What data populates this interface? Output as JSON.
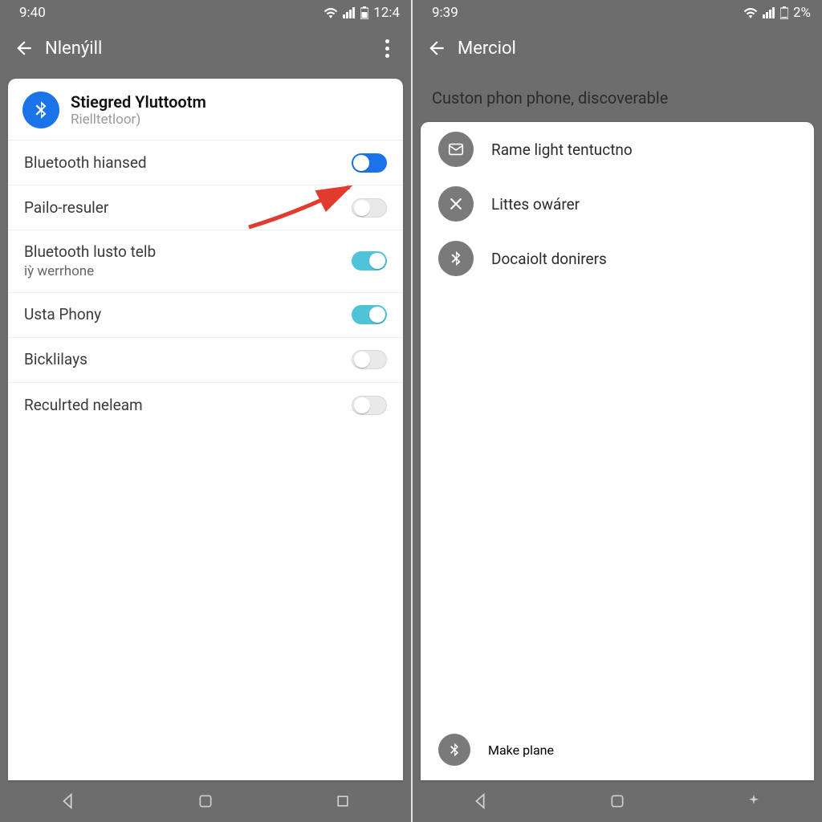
{
  "colors": {
    "accent_blue": "#1a73e8",
    "accent_teal": "#4fc3d8",
    "bg": "#6d6d6d"
  },
  "left": {
    "status": {
      "time": "9:40",
      "battery": "12:4"
    },
    "appbar": {
      "title": "Nlenýill"
    },
    "bt_header": {
      "title": "Stiegred Yluttootm",
      "subtitle": "Rielltetloor)"
    },
    "rows": [
      {
        "label": "Bluetooth hiansed",
        "sub": "",
        "state": "on-blue-dotleft"
      },
      {
        "label": "Pailo-resuler",
        "sub": "",
        "state": "off"
      },
      {
        "label": "Bluetooth lusto telb",
        "sub": "iỳ werrhone",
        "state": "on-teal"
      },
      {
        "label": "Usta Phony",
        "sub": "",
        "state": "on-teal"
      },
      {
        "label": "Bicklilays",
        "sub": "",
        "state": "off"
      },
      {
        "label": "Reculrted neleam",
        "sub": "",
        "state": "off"
      }
    ]
  },
  "right": {
    "status": {
      "time": "9:39",
      "battery": "2%"
    },
    "appbar": {
      "title": "Merciol"
    },
    "subtitle": "Custon phon phone, discoverable",
    "items": [
      {
        "icon": "mail",
        "label": "Rame light tentuctno"
      },
      {
        "icon": "close",
        "label": "Littes owárer"
      },
      {
        "icon": "bluetooth",
        "label": "Docaiolt donirers"
      }
    ],
    "footer": {
      "icon": "bluetooth",
      "label": "Make plane"
    }
  }
}
